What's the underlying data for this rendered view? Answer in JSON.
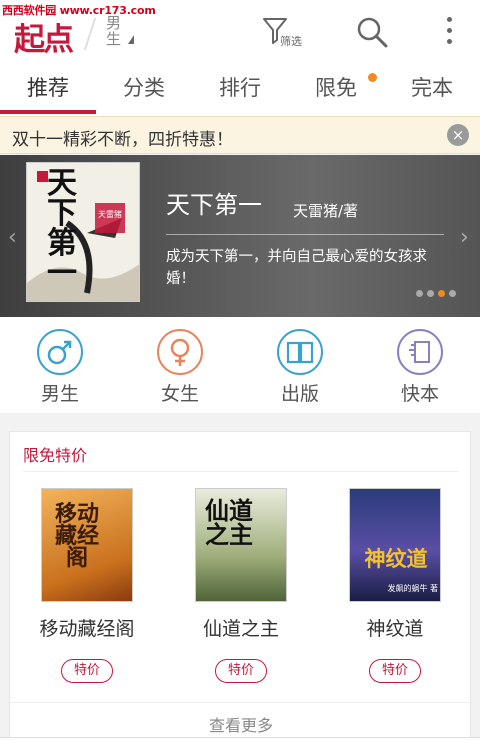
{
  "watermark": "西西软件园 www.cr173.com",
  "header": {
    "logo": "起点",
    "gender_label": "男生",
    "filter_label": "筛选"
  },
  "tabs": [
    {
      "label": "推荐",
      "active": true
    },
    {
      "label": "分类"
    },
    {
      "label": "排行"
    },
    {
      "label": "限免",
      "dot": true
    },
    {
      "label": "完本"
    }
  ],
  "notice": {
    "text": "双十一精彩不断，四折特惠！",
    "close": "×"
  },
  "banner": {
    "title": "天下第一",
    "author": "天雷猪/著",
    "description": "成为天下第一，并向自己最心爱的女孩求婚！",
    "cover_text": "天下第一",
    "cover_badge": "天雷猪",
    "prev": "‹",
    "next": "›",
    "page_count": 4,
    "active_page": 3
  },
  "categories": [
    {
      "label": "男生",
      "icon": "male-icon",
      "color": "#3aa3c9"
    },
    {
      "label": "女生",
      "icon": "female-icon",
      "color": "#e7845c"
    },
    {
      "label": "出版",
      "icon": "book-icon",
      "color": "#3aa3c9"
    },
    {
      "label": "快本",
      "icon": "fastbook-icon",
      "color": "#8a7fc0"
    }
  ],
  "limited": {
    "title": "限免特价",
    "books": [
      {
        "name": "移动藏经阁",
        "tag": "特价",
        "cover_text": "移动藏经阁"
      },
      {
        "name": "仙道之主",
        "tag": "特价",
        "cover_text": "仙道之主"
      },
      {
        "name": "神纹道",
        "tag": "特价",
        "cover_text": "神纹道",
        "cover_author": "发飙的蜗牛 著"
      }
    ],
    "more": "查看更多"
  },
  "colors": {
    "brand": "#c4193b",
    "accent": "#f08a24"
  }
}
